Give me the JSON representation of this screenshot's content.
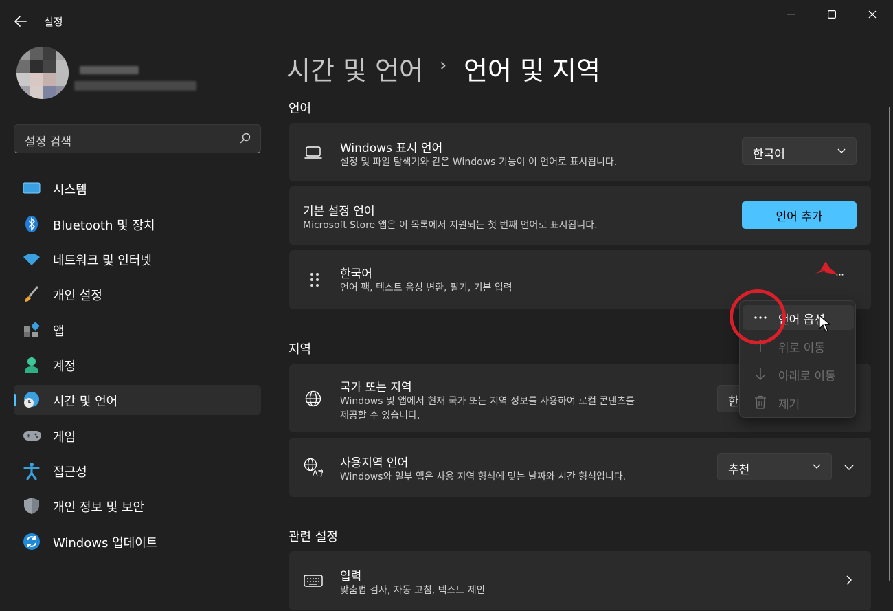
{
  "window": {
    "title": "설정",
    "back_icon": "back-arrow-icon",
    "minimize_icon": "minimize-icon",
    "maximize_icon": "maximize-icon",
    "close_icon": "close-icon"
  },
  "search": {
    "placeholder": "설정 검색",
    "icon": "search-icon"
  },
  "sidebar": {
    "items": [
      {
        "label": "시스템",
        "icon": "system-icon"
      },
      {
        "label": "Bluetooth 및 장치",
        "icon": "bluetooth-icon"
      },
      {
        "label": "네트워크 및 인터넷",
        "icon": "wifi-icon"
      },
      {
        "label": "개인 설정",
        "icon": "brush-icon"
      },
      {
        "label": "앱",
        "icon": "apps-icon"
      },
      {
        "label": "계정",
        "icon": "account-icon"
      },
      {
        "label": "시간 및 언어",
        "icon": "time-language-icon",
        "active": true
      },
      {
        "label": "게임",
        "icon": "gamepad-icon"
      },
      {
        "label": "접근성",
        "icon": "accessibility-icon"
      },
      {
        "label": "개인 정보 및 보안",
        "icon": "shield-icon"
      },
      {
        "label": "Windows 업데이트",
        "icon": "update-icon"
      }
    ]
  },
  "header": {
    "parent": "시간 및 언어",
    "separator": "›",
    "current": "언어 및 지역"
  },
  "language_section": {
    "label": "언어",
    "display_language": {
      "title": "Windows 표시 언어",
      "subtitle": "설정 및 파일 탐색기와 같은 Windows 기능이 이 언어로 표시됩니다.",
      "value": "한국어",
      "icon": "laptop-icon"
    },
    "preferred_language": {
      "title": "기본 설정 언어",
      "subtitle": "Microsoft Store 앱은 이 목록에서 지원되는 첫 번째 언어로 표시됩니다.",
      "button": "언어 추가"
    },
    "korean": {
      "title": "한국어",
      "subtitle": "언어 팩, 텍스트 음성 변환, 필기, 기본 입력",
      "more": "···",
      "icon": "drag-handle-icon"
    }
  },
  "context_menu": {
    "items": [
      {
        "label": "언어 옵션",
        "icon": "more-icon",
        "enabled": true
      },
      {
        "label": "위로 이동",
        "icon": "arrow-up-icon",
        "enabled": false
      },
      {
        "label": "아래로 이동",
        "icon": "arrow-down-icon",
        "enabled": false
      },
      {
        "label": "제거",
        "icon": "trash-icon",
        "enabled": false
      }
    ]
  },
  "region_section": {
    "label": "지역",
    "country": {
      "title": "국가 또는 지역",
      "subtitle_line1": "Windows 및 앱에서 현재 국가 또는 지역 정보를 사용하여 로컬 콘텐츠를",
      "subtitle_line2": "제공할 수 있습니다.",
      "value_partial": "한",
      "icon": "globe-icon"
    },
    "regional_format": {
      "title": "사용지역 언어",
      "subtitle": "Windows와 일부 앱은 사용 지역 형식에 맞는 날짜와 시간 형식입니다.",
      "value": "추천",
      "icon": "language-format-icon"
    }
  },
  "related_section": {
    "label": "관련 설정",
    "input": {
      "title": "입력",
      "subtitle": "맞춤법 검사, 자동 고침, 텍스트 제안",
      "icon": "keyboard-icon"
    }
  },
  "colors": {
    "accent": "#4cc2ff",
    "annotation": "#d9202a",
    "background": "#202020",
    "card": "#2b2b2b"
  }
}
